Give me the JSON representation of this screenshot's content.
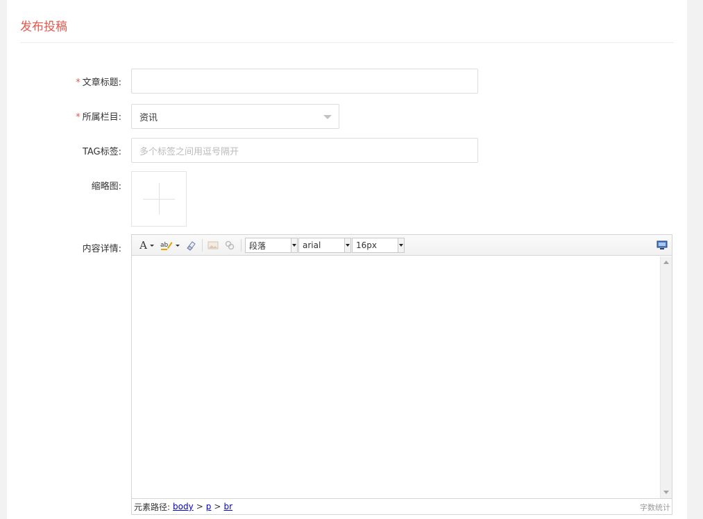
{
  "page": {
    "title": "发布投稿"
  },
  "form": {
    "required_mark": "*",
    "title_field": {
      "label": "文章标题:",
      "value": ""
    },
    "category_field": {
      "label": "所属栏目:",
      "value": "资讯"
    },
    "tag_field": {
      "label": "TAG标签:",
      "placeholder": "多个标签之间用逗号隔开"
    },
    "thumbnail_field": {
      "label": "缩略图:"
    },
    "content_field": {
      "label": "内容详情:"
    }
  },
  "editor": {
    "toolbar": {
      "font_color_icon": "A",
      "paragraph_select": "段落",
      "font_family_select": "arial",
      "font_size_select": "16px"
    },
    "statusbar": {
      "path_label": "元素路径:",
      "path": [
        "body",
        "p",
        "br"
      ],
      "path_sep": ">",
      "word_count": "字数统计"
    }
  },
  "colors": {
    "accent": "#e35a4d",
    "link": "#0000cc"
  }
}
